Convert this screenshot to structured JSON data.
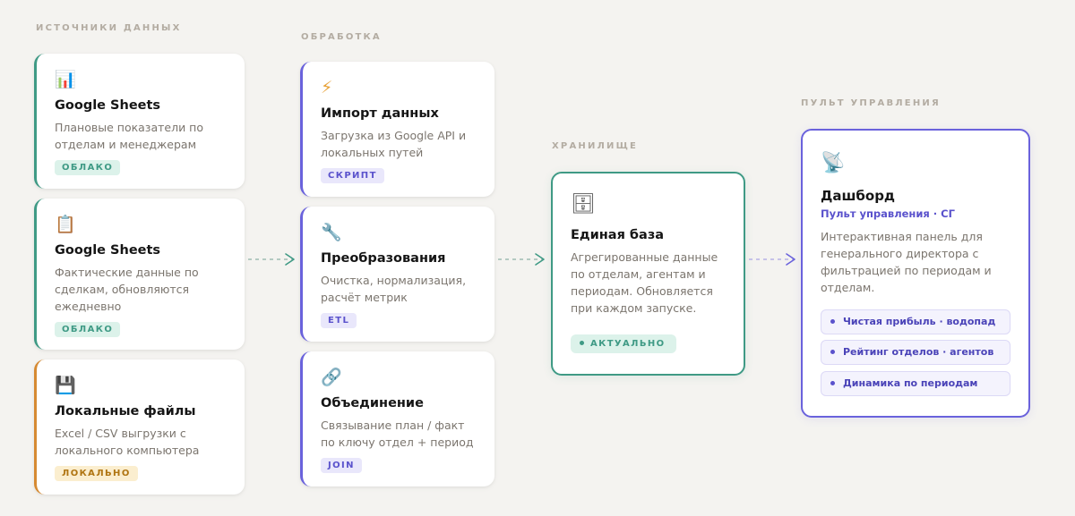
{
  "columns": {
    "sources": "ИСТОЧНИКИ ДАННЫХ",
    "processing": "ОБРАБОТКА",
    "storage": "ХРАНИЛИЩЕ",
    "control": "ПУЛЬТ УПРАВЛЕНИЯ"
  },
  "sources": [
    {
      "icon": "📊",
      "icon_name": "bar-chart-icon",
      "title": "Google Sheets",
      "desc": "Плановые показатели по отделам и менеджерам",
      "tag": "ОБЛАКО"
    },
    {
      "icon": "📋",
      "icon_name": "clipboard-icon",
      "title": "Google Sheets",
      "desc": "Фактические данные по сделкам, обновляются ежедневно",
      "tag": "ОБЛАКО"
    },
    {
      "icon": "💾",
      "icon_name": "floppy-disk-icon",
      "title": "Локальные файлы",
      "desc": "Excel / CSV выгрузки с локального компьютера",
      "tag": "ЛОКАЛЬНО"
    }
  ],
  "processing": [
    {
      "icon": "⚡",
      "icon_name": "lightning-icon",
      "title": "Импорт данных",
      "desc": "Загрузка из Google API и локальных путей",
      "tag": "СКРИПТ"
    },
    {
      "icon": "🔧",
      "icon_name": "wrench-icon",
      "title": "Преобразования",
      "desc": "Очистка, нормализация, расчёт метрик",
      "tag": "ETL"
    },
    {
      "icon": "🔗",
      "icon_name": "link-icon",
      "title": "Объединение",
      "desc": "Связывание план / факт по ключу отдел + период",
      "tag": "JOIN"
    }
  ],
  "storage": {
    "icon": "🗄",
    "icon_name": "file-cabinet-icon",
    "title": "Единая база",
    "desc": "Агрегированные данные по отделам, агентам и периодам. Обновляется при каждом запуске.",
    "status": "АКТУАЛЬНО"
  },
  "dashboard": {
    "icon": "📡",
    "icon_name": "satellite-dish-icon",
    "title": "Дашборд",
    "subtitle": "Пульт управления · СГ",
    "desc": "Интерактивная панель для генерального директора с фильтрацией по периодам и отделам.",
    "metrics": [
      "Чистая прибыль · водопад",
      "Рейтинг отделов · агентов",
      "Динамика по периодам"
    ]
  },
  "colors": {
    "background": "#f4f3f0",
    "cloud_accent": "#3f9a85",
    "local_accent": "#d68a32",
    "processing_accent": "#6a62dc",
    "arrow": "#9fbdb2"
  }
}
